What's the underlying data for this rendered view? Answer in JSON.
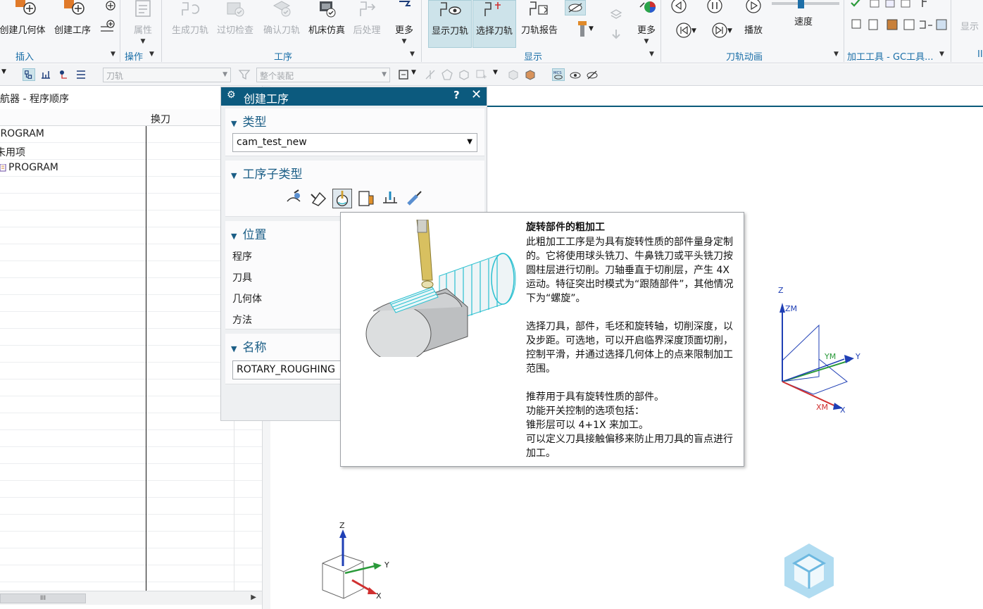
{
  "ribbon": {
    "insert": {
      "label": "插入",
      "create_geometry": "创建几何体",
      "create_operation": "创建工序"
    },
    "operate": {
      "label": "操作",
      "properties": "属性"
    },
    "operation": {
      "label": "工序",
      "generate_toolpath": "生成刀轨",
      "gouge_check": "过切检查",
      "verify_toolpath": "确认刀轨",
      "machine_simulation": "机床仿真",
      "postprocess": "后处理",
      "more": "更多"
    },
    "display": {
      "label": "显示",
      "show_toolpath": "显示刀轨",
      "select_toolpath": "选择刀轨",
      "toolpath_report": "刀轨报告",
      "more": "更多"
    },
    "animation": {
      "label": "刀轨动画",
      "play": "播放",
      "speed": "速度"
    },
    "machining_tools": {
      "label": "加工工具 - GC工具..."
    },
    "display_right": "显示",
    "extra_group_fragment": "II"
  },
  "toolbar": {
    "toolpath_filter": "刀轨",
    "assembly_filter": "整个装配"
  },
  "navigator": {
    "title": "导航器 - 程序顺序",
    "col_tool_change": "换刀",
    "rows": [
      "PROGRAM",
      "未用项",
      "PROGRAM"
    ],
    "scroll_glyph": "III"
  },
  "dialog": {
    "title": "创建工序",
    "help": "?",
    "close": "✕",
    "type_section": "类型",
    "type_value": "cam_test_new",
    "subtype_section": "工序子类型",
    "location_section": "位置",
    "program_label": "程序",
    "tool_label": "刀具",
    "geometry_label": "几何体",
    "method_label": "方法",
    "name_section": "名称",
    "name_value": "ROTARY_ROUGHING"
  },
  "tooltip": {
    "title": "旋转部件的粗加工",
    "para1": "此粗加工工序是为具有旋转性质的部件量身定制的。它将使用球头铣刀、牛鼻铣刀或平头铣刀按圆柱层进行切削。刀轴垂直于切削层，产生 4X 运动。特征突出时模式为“跟随部件”，其他情况下为“螺旋”。",
    "para2": "选择刀具，部件，毛坯和旋转轴，切削深度，以及步距。可选地，可以开启临界深度顶面切削，控制平滑，并通过选择几何体上的点来限制加工范围。",
    "line3": "推荐用于具有旋转性质的部件。",
    "line4": "功能开关控制的选项包括：",
    "line5": "锥形层可以 4+1X 来加工。",
    "line6": "可以定义刀具接触偏移来防止用刀具的盲点进行加工。"
  },
  "csys": {
    "z": "Z",
    "zm": "ZM",
    "y": "Y",
    "ym": "YM",
    "x": "X",
    "xm": "XM"
  },
  "triad": {
    "z": "Z",
    "y": "Y",
    "x": "X"
  },
  "colors": {
    "dialog_title_bg": "#0c5a7e",
    "accent_blue": "#1b6fa8",
    "active_button": "#cde3ea",
    "axis_z": "#1f3fb5",
    "axis_x": "#d03030",
    "axis_y": "#2a9a3a"
  }
}
